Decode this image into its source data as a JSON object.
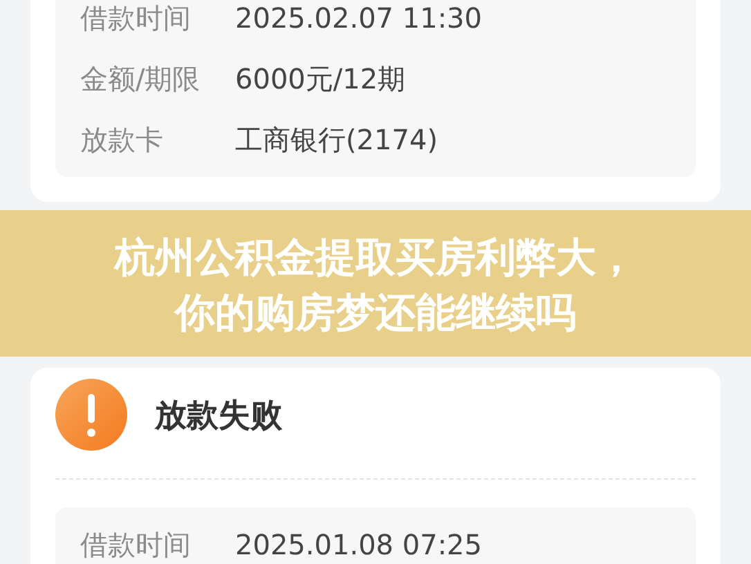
{
  "top_card": {
    "fields": [
      {
        "label": "借款时间",
        "value": "2025.02.07 11:30"
      },
      {
        "label": "金额/期限",
        "value": "6000元/12期"
      },
      {
        "label": "放款卡",
        "value": "工商银行(2174)"
      }
    ]
  },
  "banner": {
    "lines": [
      "杭州公积金提取买房利弊大，",
      "你的购房梦还能继续吗"
    ]
  },
  "status_card": {
    "kind": "warning",
    "status": "放款失败",
    "fields": [
      {
        "label": "借款时间",
        "value": "2025.01.08 07:25"
      }
    ]
  }
}
